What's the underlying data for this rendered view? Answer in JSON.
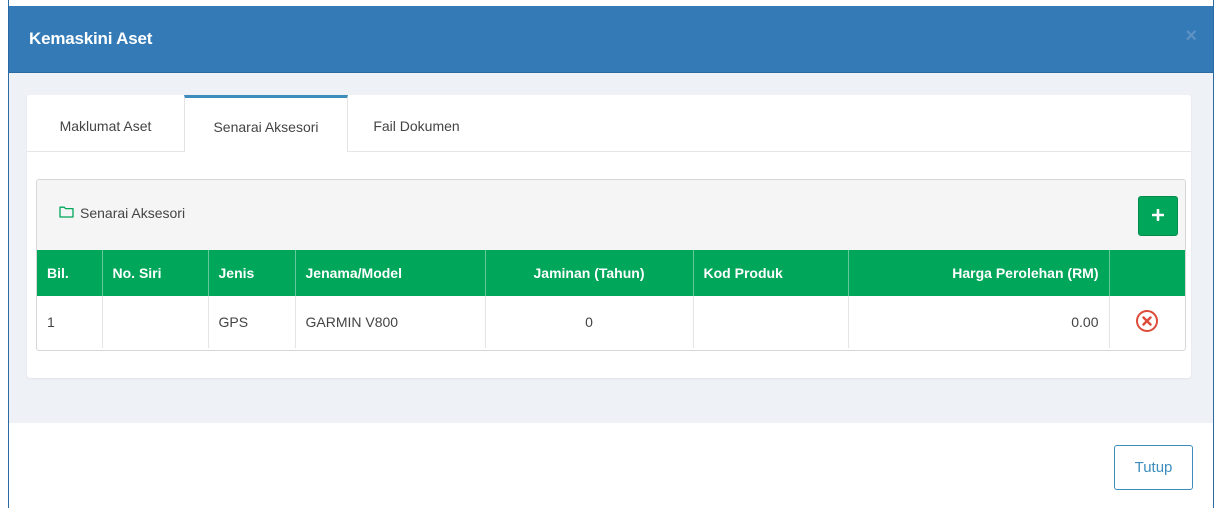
{
  "modal": {
    "title": "Kemaskini Aset",
    "close_label": "×"
  },
  "tabs": [
    {
      "label": "Maklumat Aset",
      "active": false
    },
    {
      "label": "Senarai Aksesori",
      "active": true
    },
    {
      "label": "Fail Dokumen",
      "active": false
    }
  ],
  "panel": {
    "title": "Senarai Aksesori",
    "title_icon": "folder-outline-icon",
    "add_icon": "plus-icon"
  },
  "table": {
    "headers": [
      "Bil.",
      "No. Siri",
      "Jenis",
      "Jenama/Model",
      "Jaminan (Tahun)",
      "Kod Produk",
      "Harga Perolehan (RM)",
      ""
    ],
    "rows": [
      {
        "bil": "1",
        "no_siri": "",
        "jenis": "GPS",
        "jenama_model": "GARMIN V800",
        "jaminan": "0",
        "kod_produk": "",
        "harga": "0.00",
        "action_icon": "delete-circle-x-icon"
      }
    ]
  },
  "footer": {
    "close_button": "Tutup"
  },
  "colors": {
    "header_blue": "#337ab7",
    "table_green": "#00a65a",
    "delete_red": "#dd4b39",
    "tab_active_border": "#3c8dbc"
  }
}
